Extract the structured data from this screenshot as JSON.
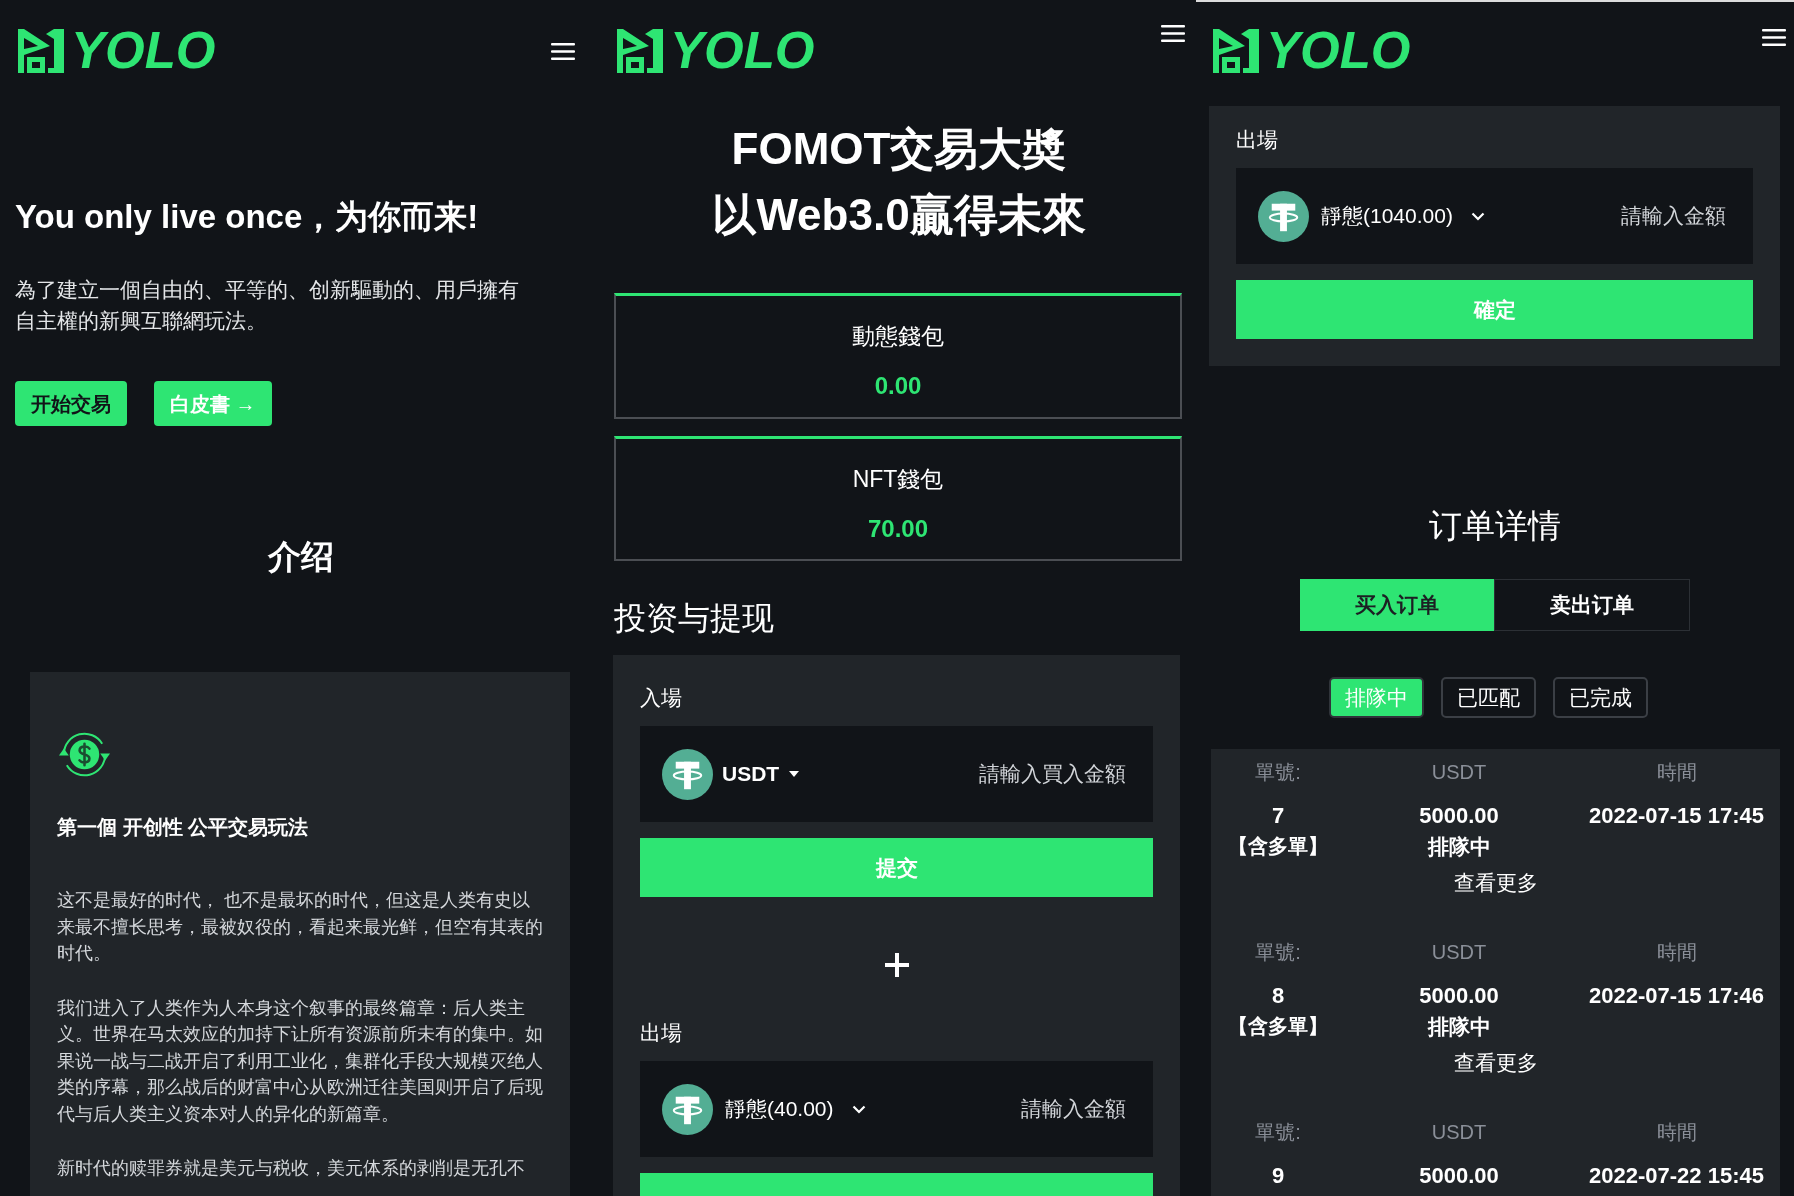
{
  "screens": [
    {
      "kind": "home",
      "header": {
        "logo_text": "YOLO"
      },
      "hero": {
        "title": "You only live once，为你而来!",
        "description": "為了建立一個自由的、平等的、创新驅動的、用戶擁有自主權的新興互聯網玩法。",
        "buttons": [
          {
            "label": "开始交易",
            "kind": "primary"
          },
          {
            "label": "白皮書 →",
            "kind": "secondary"
          }
        ]
      },
      "intro": {
        "title": "介绍",
        "card": {
          "heading": "第一個 开创性 公平交易玩法",
          "paragraphs": [
            "这不是最好的时代， 也不是最坏的时代，但这是人类有史以来最不擅长思考，最被奴役的，看起来最光鲜，但空有其表的时代。",
            "我们进入了人类作为人本身这个叙事的最终篇章：后人类主义。世界在马太效应的加持下让所有资源前所未有的集中。如果说一战与二战开启了利用工业化，集群化手段大规模灭绝人类的序幕，那么战后的财富中心从欧洲迁往美国则开启了后现代与后人类主义资本对人的异化的新篇章。",
            "新时代的赎罪券就是美元与税收，美元体系的剥削是无孔不"
          ]
        }
      }
    },
    {
      "kind": "wallet",
      "header": {
        "logo_text": "YOLO"
      },
      "title_lines": [
        "FOMOT交易大奬",
        "以Web3.0贏得未來"
      ],
      "wallets": [
        {
          "label": "動態錢包",
          "amount": "0.00"
        },
        {
          "label": "NFT錢包",
          "amount": "70.00"
        }
      ],
      "section_title": "投资与提现",
      "panels": [
        {
          "label": "入場",
          "selector": {
            "kind": "token",
            "text": "USDT"
          },
          "placeholder": "請輸入買入金額",
          "button": "提交"
        },
        {
          "label": "出場",
          "selector": {
            "kind": "balance",
            "text": "靜態(40.00)"
          },
          "placeholder": "請輸入金額",
          "partial_button": true
        }
      ]
    },
    {
      "kind": "orders",
      "header": {
        "logo_text": "YOLO"
      },
      "panels": [
        {
          "label": "出場",
          "selector": {
            "kind": "balance",
            "text": "靜態(1040.00)"
          },
          "placeholder": "請輸入金額",
          "button": "確定"
        }
      ],
      "orders_title": "订单详情",
      "tabs": [
        {
          "label": "买入订单",
          "selected": true
        },
        {
          "label": "卖出订单",
          "selected": false
        }
      ],
      "filters": [
        {
          "label": "排隊中",
          "selected": true
        },
        {
          "label": "已匹配",
          "selected": false
        },
        {
          "label": "已完成",
          "selected": false
        }
      ],
      "orders": [
        {
          "column_labels": [
            "單號:",
            "USDT",
            "時間"
          ],
          "number": "7",
          "tag": "【含多單】",
          "amount": "5000.00",
          "status": "排隊中",
          "time": "2022-07-15 17:45",
          "more": "查看更多"
        },
        {
          "column_labels": [
            "單號:",
            "USDT",
            "時間"
          ],
          "number": "8",
          "tag": "【含多單】",
          "amount": "5000.00",
          "status": "排隊中",
          "time": "2022-07-15 17:46",
          "more": "查看更多"
        },
        {
          "column_labels": [
            "單號:",
            "USDT",
            "時間"
          ],
          "number": "9",
          "amount": "5000.00",
          "time": "2022-07-22 15:45"
        }
      ]
    }
  ]
}
